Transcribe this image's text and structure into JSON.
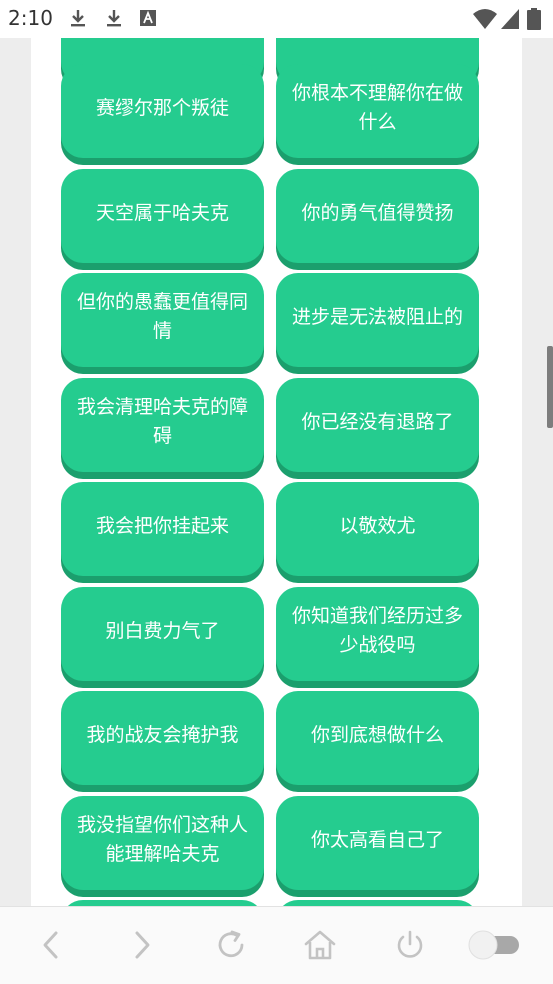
{
  "status_bar": {
    "time": "2:10",
    "icons": [
      "download-icon",
      "download-icon",
      "app-notification-icon",
      "wifi-icon",
      "signal-icon",
      "battery-icon"
    ]
  },
  "buttons": [
    {
      "label": ""
    },
    {
      "label": ""
    },
    {
      "label": "赛缪尔那个叛徒"
    },
    {
      "label": "你根本不理解你在做什么"
    },
    {
      "label": "天空属于哈夫克"
    },
    {
      "label": "你的勇气值得赞扬"
    },
    {
      "label": "但你的愚蠢更值得同情"
    },
    {
      "label": "进步是无法被阻止的"
    },
    {
      "label": "我会清理哈夫克的障碍"
    },
    {
      "label": "你已经没有退路了"
    },
    {
      "label": "我会把你挂起来"
    },
    {
      "label": "以敬效尤"
    },
    {
      "label": "别白费力气了"
    },
    {
      "label": "你知道我们经历过多少战役吗"
    },
    {
      "label": "我的战友会掩护我"
    },
    {
      "label": "你到底想做什么"
    },
    {
      "label": "我没指望你们这种人能理解哈夫克"
    },
    {
      "label": "你太高看自己了"
    },
    {
      "label": ""
    },
    {
      "label": ""
    }
  ],
  "colors": {
    "button": "#25cc8f",
    "button_shadow": "#1b9f6d",
    "page_background": "#ededed",
    "content_background": "#ffffff"
  },
  "bottom_nav": {
    "icons": [
      "back-arrow-icon",
      "forward-arrow-icon",
      "refresh-icon",
      "home-icon",
      "power-icon",
      "toggle-switch-icon"
    ]
  }
}
